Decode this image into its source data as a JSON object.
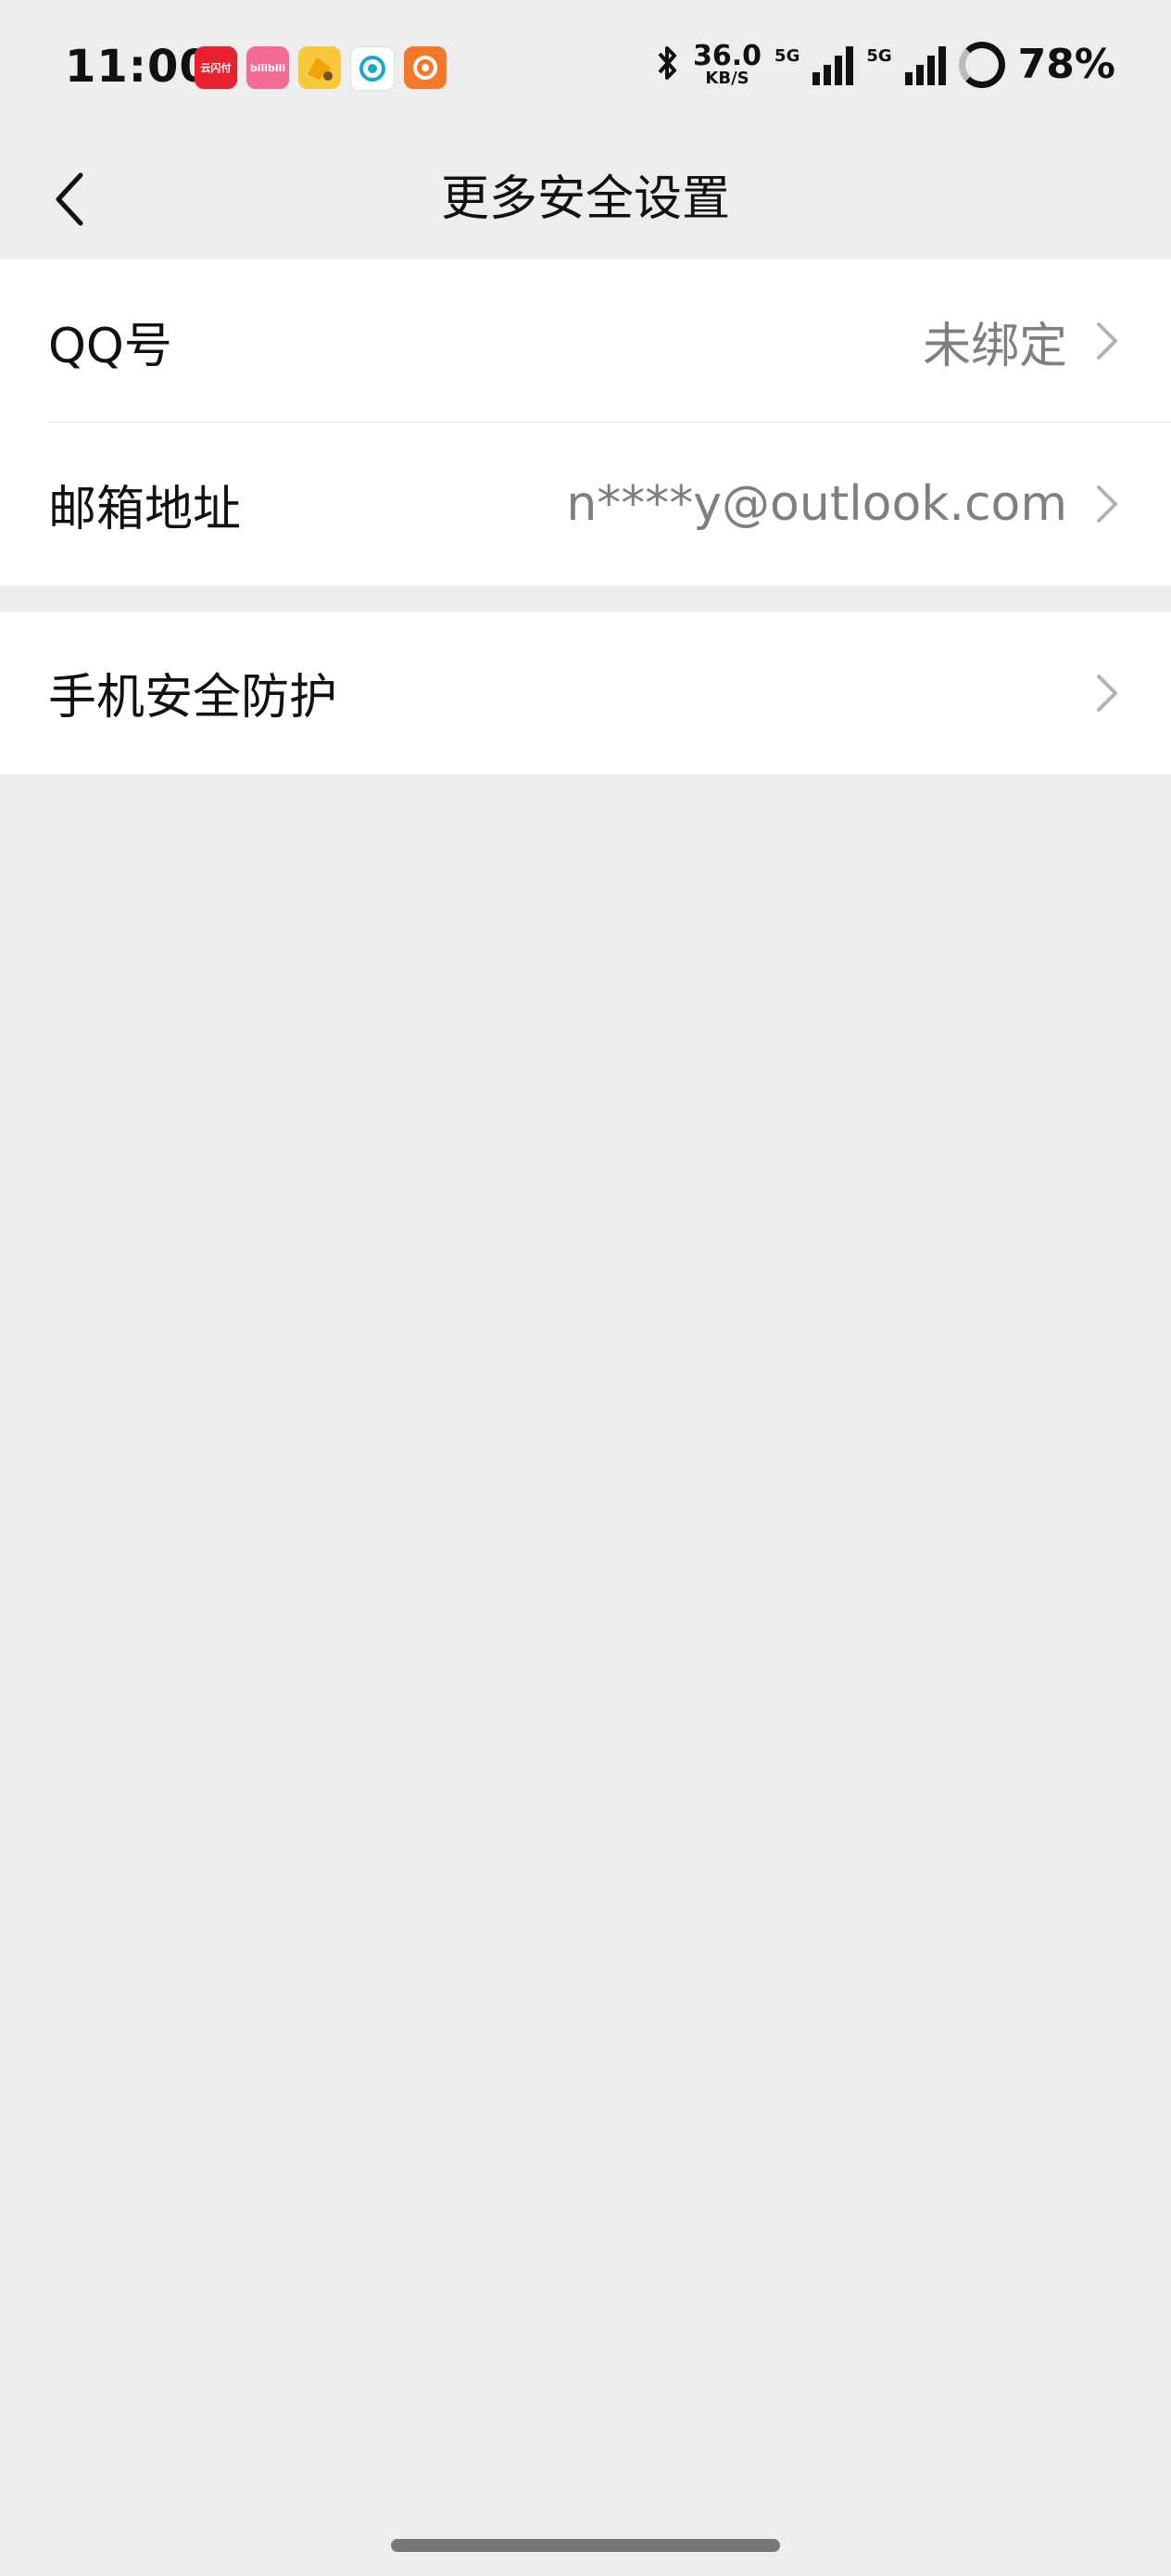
{
  "status_bar": {
    "time": "11:00",
    "app_icons": [
      {
        "name": "unionpay-app-icon",
        "label": "云闪付",
        "color": "#e8232f"
      },
      {
        "name": "bilibili-app-icon",
        "label": "bilibili",
        "color": "#f26c93"
      },
      {
        "name": "game-app-icon",
        "label": "",
        "color": "#f7c83b"
      },
      {
        "name": "china-mobile-app-icon",
        "label": "",
        "color": "#ffffff"
      },
      {
        "name": "orange-app-icon",
        "label": "",
        "color": "#f5772a"
      }
    ],
    "network_speed": "36.0",
    "network_speed_unit": "KB/S",
    "sim1_label": "5G",
    "sim2_label": "5G",
    "battery_percent": "78%",
    "icons": [
      "bluetooth-icon",
      "signal-icon",
      "battery-icon"
    ]
  },
  "nav": {
    "title": "更多安全设置",
    "back_icon": "chevron-left-icon"
  },
  "groups": [
    {
      "rows": [
        {
          "label": "QQ号",
          "value": "未绑定",
          "icon": "chevron-right-icon"
        },
        {
          "label": "邮箱地址",
          "value": "n****y@outlook.com",
          "icon": "chevron-right-icon"
        }
      ]
    },
    {
      "rows": [
        {
          "label": "手机安全防护",
          "value": "",
          "icon": "chevron-right-icon"
        }
      ]
    }
  ],
  "colors": {
    "background": "#ededed",
    "card": "#ffffff",
    "secondary_text": "#7f7f7f",
    "chevron": "#b2b2b2"
  }
}
